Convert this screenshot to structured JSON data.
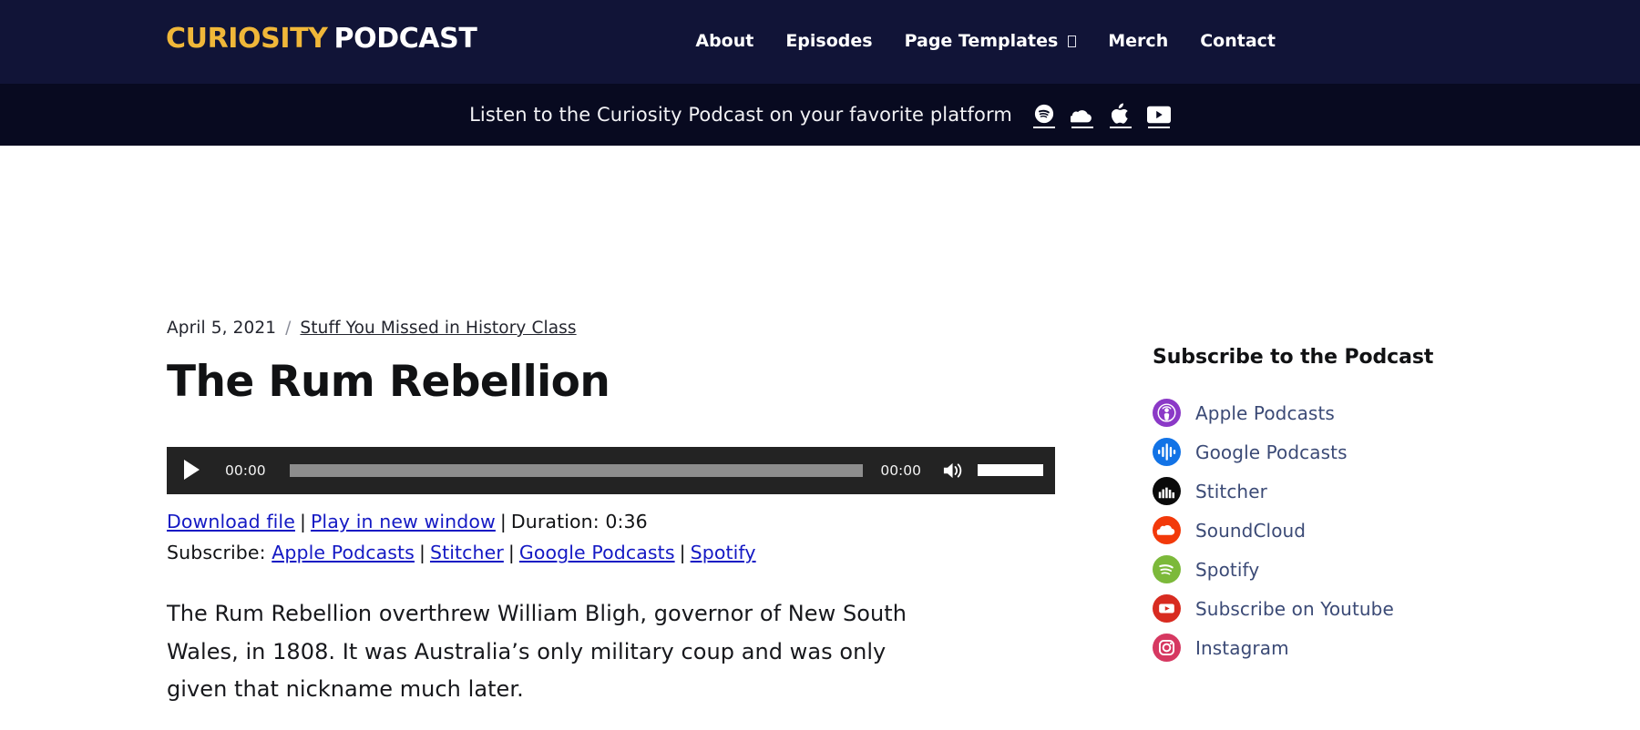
{
  "header": {
    "brand_primary": "CURIOSITY",
    "brand_secondary": "PODCAST",
    "brand_primary_color": "#f0b739",
    "background": "#111437",
    "nav": [
      {
        "label": "About",
        "has_caret": false
      },
      {
        "label": "Episodes",
        "has_caret": false
      },
      {
        "label": "Page Templates",
        "has_caret": true
      },
      {
        "label": "Merch",
        "has_caret": false
      },
      {
        "label": "Contact",
        "has_caret": false
      }
    ]
  },
  "sub_bar": {
    "background": "#080a20",
    "text": "Listen to the Curiosity Podcast on your favorite platform",
    "icons": [
      {
        "name": "spotify-icon"
      },
      {
        "name": "soundcloud-icon"
      },
      {
        "name": "apple-icon"
      },
      {
        "name": "youtube-icon"
      }
    ]
  },
  "post": {
    "date": "April 5, 2021",
    "separator": "/",
    "category": "Stuff You Missed in History Class",
    "title": "The Rum Rebellion",
    "body": "The Rum Rebellion overthrew William Bligh, governor of New South Wales, in 1808. It was Australia’s only military coup and was only given that nickname much later."
  },
  "player": {
    "current_time": "00:00",
    "duration_time": "00:00",
    "play_label": "Play",
    "mute_label": "Mute",
    "progress_percent": 0,
    "volume_percent": 100
  },
  "player_links": {
    "download": "Download file",
    "new_window": "Play in new window",
    "duration": "Duration: 0:36",
    "pipe": "|",
    "subscribe_label": "Subscribe:",
    "subscribe_links": [
      "Apple Podcasts",
      "Stitcher",
      "Google Podcasts",
      "Spotify"
    ]
  },
  "sidebar": {
    "title": "Subscribe to the Podcast",
    "items": [
      {
        "label": "Apple Podcasts",
        "icon": "apple-podcasts-icon",
        "color": "#8b39c7"
      },
      {
        "label": "Google Podcasts",
        "icon": "google-podcasts-icon",
        "color": "#1273e6"
      },
      {
        "label": "Stitcher",
        "icon": "stitcher-icon",
        "color": "#0a0a0a"
      },
      {
        "label": "SoundCloud",
        "icon": "soundcloud-icon",
        "color": "#f23b০0"
      },
      {
        "label": "Spotify",
        "icon": "spotify-icon",
        "color": "#7cb93a"
      },
      {
        "label": "Subscribe on Youtube",
        "icon": "youtube-icon",
        "color": "#d82b20"
      },
      {
        "label": "Instagram",
        "icon": "instagram-icon",
        "color": "#d63861"
      }
    ]
  }
}
